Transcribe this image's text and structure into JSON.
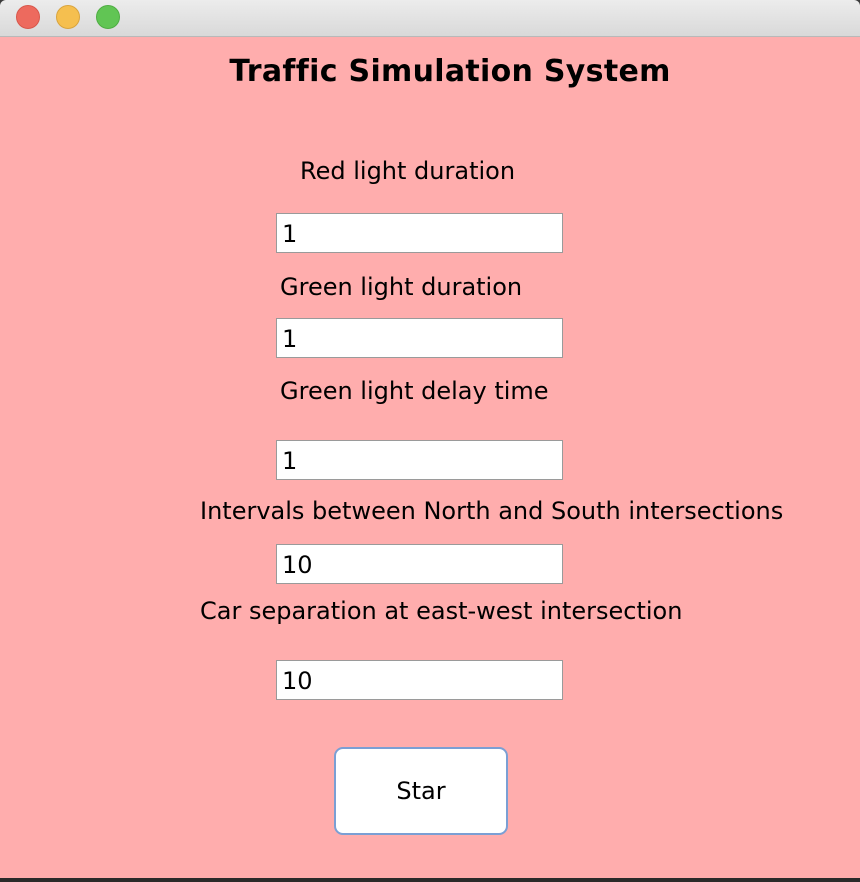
{
  "window": {
    "controls": [
      {
        "name": "close",
        "color": "#ed6a5e"
      },
      {
        "name": "minimize",
        "color": "#f5bf4f"
      },
      {
        "name": "maximize",
        "color": "#61c554"
      }
    ]
  },
  "theme": {
    "background": "#ffadad",
    "field_background": "#ffffff",
    "button_border": "#7b9fd4"
  },
  "form": {
    "title": "Traffic Simulation System",
    "fields": [
      {
        "label": "Red light duration",
        "value": "1"
      },
      {
        "label": "Green light duration",
        "value": "1"
      },
      {
        "label": "Green light delay time",
        "value": "1"
      },
      {
        "label": "Intervals between North and South intersections",
        "value": "10"
      },
      {
        "label": "Car separation at east-west intersection",
        "value": "10"
      }
    ],
    "start_label": "Star"
  }
}
